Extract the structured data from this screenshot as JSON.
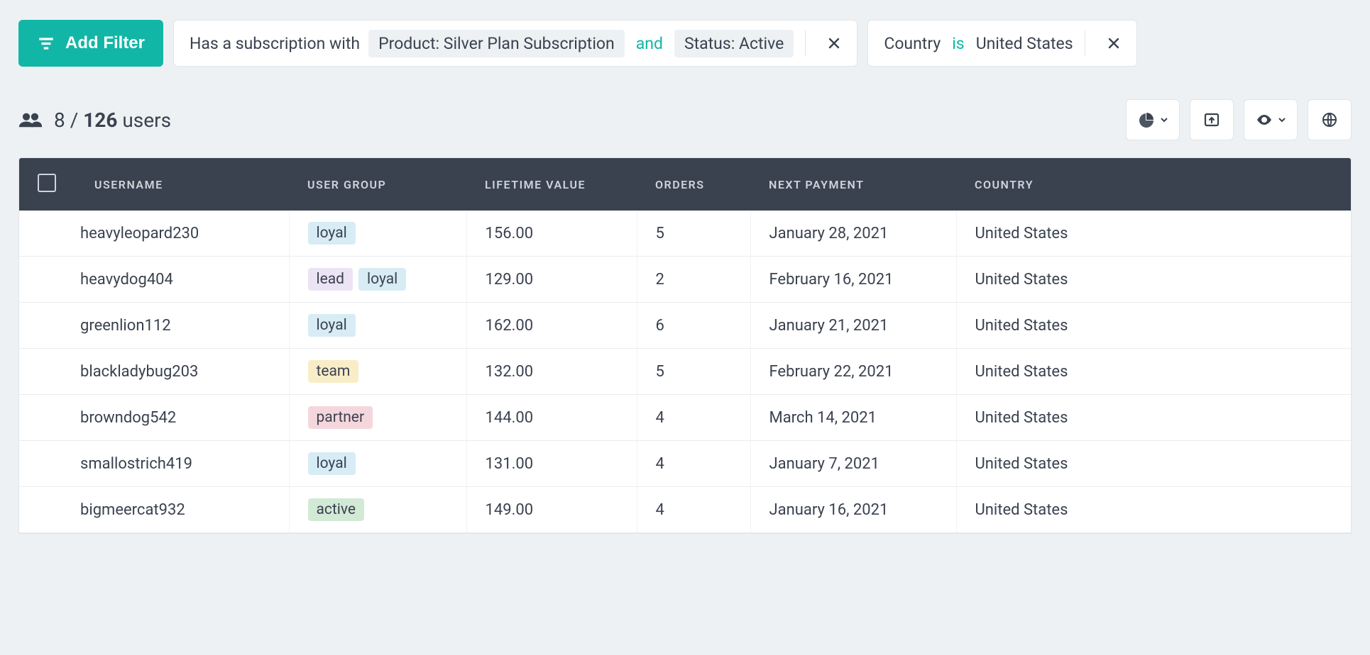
{
  "filter_bar": {
    "add_filter_label": "Add Filter",
    "chips": [
      {
        "prefix": "Has a subscription with",
        "parts": [
          {
            "kind": "chip",
            "text": "Product: Silver Plan Subscription"
          },
          {
            "kind": "op",
            "text": "and"
          },
          {
            "kind": "chip",
            "text": "Status: Active"
          }
        ]
      },
      {
        "prefix": "Country",
        "parts": [
          {
            "kind": "op",
            "text": "is"
          },
          {
            "kind": "text",
            "text": "United States"
          }
        ]
      }
    ]
  },
  "summary": {
    "visible": "8",
    "separator": "/",
    "total": "126",
    "unit": "users"
  },
  "toolbar_icons": {
    "chart": "pie-chart-icon",
    "export": "export-icon",
    "visibility": "eye-icon",
    "globe": "globe-icon"
  },
  "table": {
    "columns": [
      "USERNAME",
      "USER GROUP",
      "LIFETIME VALUE",
      "ORDERS",
      "NEXT PAYMENT",
      "COUNTRY"
    ],
    "rows": [
      {
        "avatar_color": "#5a2d2d",
        "username": "heavyleopard230",
        "groups": [
          "loyal"
        ],
        "ltv": "156.00",
        "orders": "5",
        "next_payment": "January 28, 2021",
        "country": "United States"
      },
      {
        "avatar_color": "#c03a3a",
        "username": "heavydog404",
        "groups": [
          "lead",
          "loyal"
        ],
        "ltv": "129.00",
        "orders": "2",
        "next_payment": "February 16, 2021",
        "country": "United States"
      },
      {
        "avatar_color": "#e6e0d8",
        "username": "greenlion112",
        "groups": [
          "loyal"
        ],
        "ltv": "162.00",
        "orders": "6",
        "next_payment": "January 21, 2021",
        "country": "United States"
      },
      {
        "avatar_color": "#8a6a3a",
        "username": "blackladybug203",
        "groups": [
          "team"
        ],
        "ltv": "132.00",
        "orders": "5",
        "next_payment": "February 22, 2021",
        "country": "United States"
      },
      {
        "avatar_color": "#d4c7b8",
        "username": "browndog542",
        "groups": [
          "partner"
        ],
        "ltv": "144.00",
        "orders": "4",
        "next_payment": "March 14, 2021",
        "country": "United States"
      },
      {
        "avatar_color": "#caa98a",
        "username": "smallostrich419",
        "groups": [
          "loyal"
        ],
        "ltv": "131.00",
        "orders": "4",
        "next_payment": "January 7, 2021",
        "country": "United States"
      },
      {
        "avatar_color": "#6b5a4a",
        "username": "bigmeercat932",
        "groups": [
          "active"
        ],
        "ltv": "149.00",
        "orders": "4",
        "next_payment": "January 16, 2021",
        "country": "United States"
      }
    ]
  }
}
